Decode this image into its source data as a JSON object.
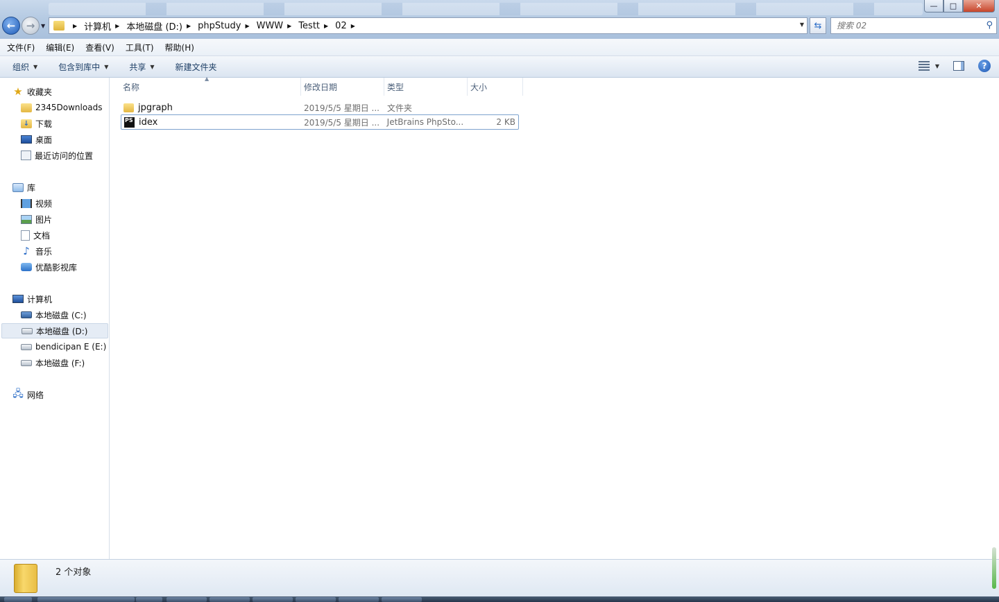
{
  "window": {
    "controls": {
      "minimize": "—",
      "maximize": "□",
      "close": "✕"
    }
  },
  "nav": {
    "back_icon": "arrow-left",
    "forward_icon": "arrow-right"
  },
  "address": {
    "crumbs": [
      "计算机",
      "本地磁盘 (D:)",
      "phpStudy",
      "WWW",
      "Testt",
      "02"
    ]
  },
  "search": {
    "placeholder": "搜索 02"
  },
  "menubar": [
    "文件(F)",
    "编辑(E)",
    "查看(V)",
    "工具(T)",
    "帮助(H)"
  ],
  "toolbar": {
    "organize": "组织",
    "include_library": "包含到库中",
    "share": "共享",
    "new_folder": "新建文件夹"
  },
  "sidebar": {
    "favorites": {
      "label": "收藏夹",
      "items": [
        "2345Downloads",
        "下载",
        "桌面",
        "最近访问的位置"
      ]
    },
    "libraries": {
      "label": "库",
      "items": [
        "视频",
        "图片",
        "文档",
        "音乐",
        "优酷影视库"
      ]
    },
    "computer": {
      "label": "计算机",
      "items": [
        "本地磁盘 (C:)",
        "本地磁盘 (D:)",
        "bendicipan E (E:)",
        "本地磁盘 (F:)"
      ]
    },
    "network": {
      "label": "网络"
    }
  },
  "columns": [
    "名称",
    "修改日期",
    "类型",
    "大小"
  ],
  "files": [
    {
      "name": "jpgraph",
      "date": "2019/5/5 星期日 ...",
      "type": "文件夹",
      "size": ""
    },
    {
      "name": "idex",
      "date": "2019/5/5 星期日 ...",
      "type": "JetBrains PhpSto...",
      "size": "2 KB"
    }
  ],
  "status": {
    "text": "2 个对象"
  },
  "colors": {
    "selection_border": "#7da2ce",
    "header_text": "#4c607a",
    "toolbar_text": "#1e3f66"
  }
}
